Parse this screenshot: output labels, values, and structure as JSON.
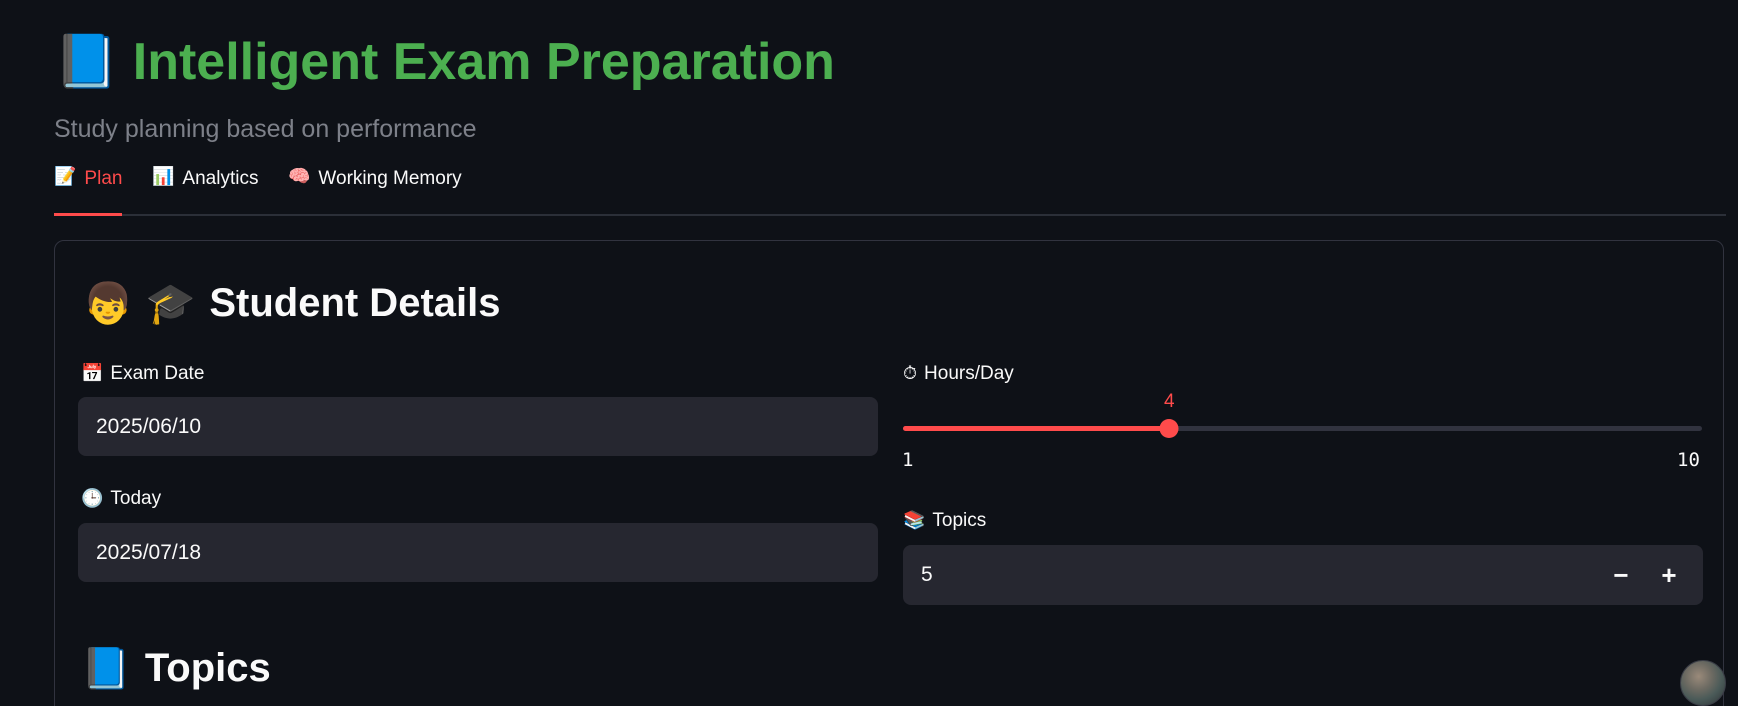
{
  "header": {
    "icon": "📘",
    "title": "Intelligent Exam Preparation",
    "subtitle": "Study planning based on performance"
  },
  "tabs": [
    {
      "icon": "📝",
      "label": "Plan",
      "active": true
    },
    {
      "icon": "📊",
      "label": "Analytics",
      "active": false
    },
    {
      "icon": "🧠",
      "label": "Working Memory",
      "active": false
    }
  ],
  "student_details": {
    "icons": "👦 🎓",
    "title": "Student Details",
    "exam_date": {
      "icon": "📅",
      "label": "Exam Date",
      "value": "2025/06/10"
    },
    "today": {
      "icon": "🕒",
      "label": "Today",
      "value": "2025/07/18"
    },
    "hours_per_day": {
      "icon": "⏱",
      "label": "Hours/Day",
      "value": 4,
      "min": 1,
      "max": 10
    },
    "topics": {
      "icon": "📚",
      "label": "Topics",
      "value": "5",
      "decrement": "−",
      "increment": "+"
    }
  },
  "topics_section": {
    "icon": "📘",
    "title": "Topics"
  },
  "colors": {
    "accent": "#ff4b4b",
    "title_green": "#4caf50",
    "background": "#0e1117",
    "input_bg": "#262730"
  },
  "icon_names": {
    "avatar": "user-avatar"
  }
}
